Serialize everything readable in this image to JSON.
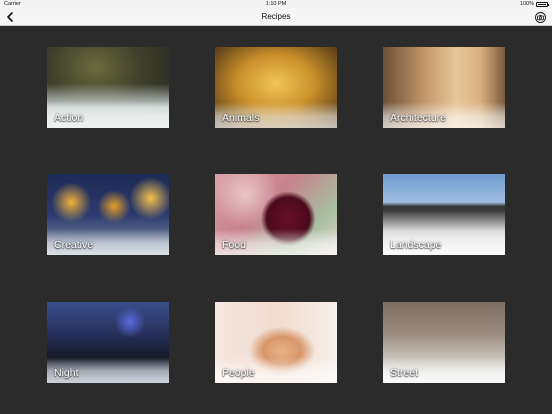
{
  "status_bar": {
    "carrier": "Carrier",
    "time": "1:10 PM",
    "battery": "100%"
  },
  "nav": {
    "title": "Recipes",
    "back_icon": "chevron-left-icon",
    "camera_icon": "camera-icon"
  },
  "categories": [
    {
      "label": "Action"
    },
    {
      "label": "Animals"
    },
    {
      "label": "Architecture"
    },
    {
      "label": "Creative"
    },
    {
      "label": "Food"
    },
    {
      "label": "Landscape"
    },
    {
      "label": "Night"
    },
    {
      "label": "People"
    },
    {
      "label": "Street"
    }
  ],
  "colors": {
    "background": "#2b2b2b",
    "nav_background": "#f6f6f6",
    "label_text": "#ffffff"
  }
}
